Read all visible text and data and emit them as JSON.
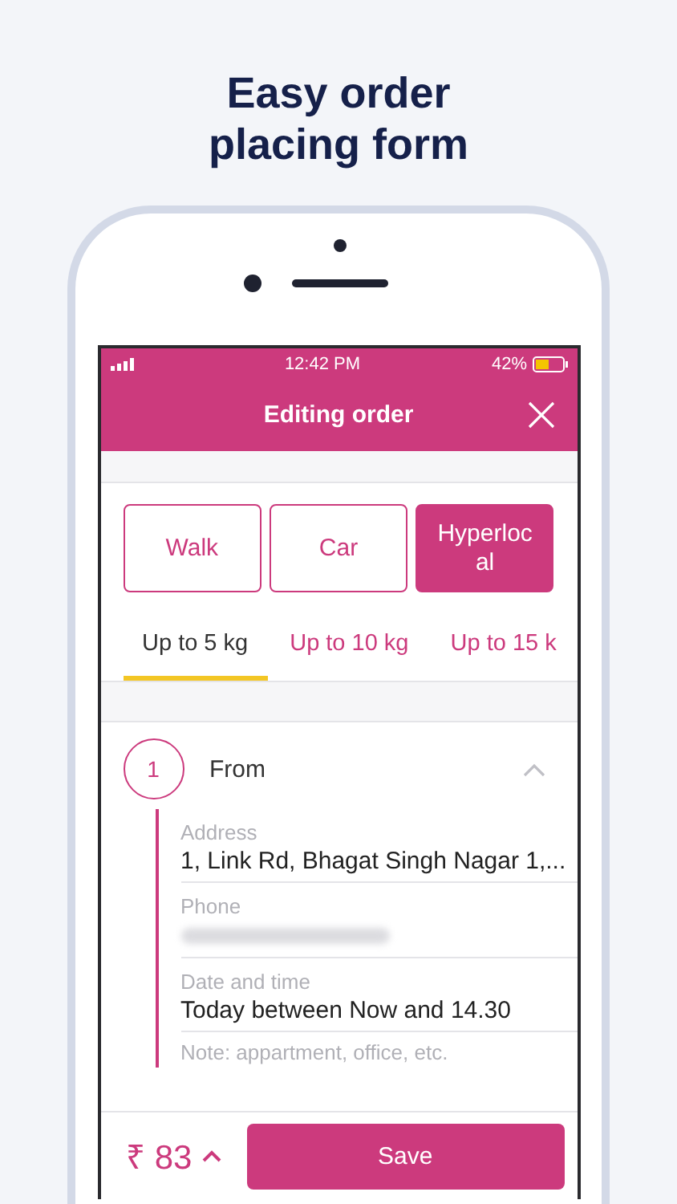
{
  "headline": "Easy order placing form",
  "status_bar": {
    "time": "12:42 PM",
    "battery": "42%"
  },
  "header": {
    "title": "Editing order"
  },
  "transport_options": [
    {
      "label": "Walk",
      "selected": false
    },
    {
      "label": "Car",
      "selected": false
    },
    {
      "label": "Hyperlocal",
      "selected": true
    }
  ],
  "weight_tabs": [
    {
      "label": "Up to 5 kg",
      "selected": true
    },
    {
      "label": "Up to 10 kg",
      "selected": false
    },
    {
      "label": "Up to 15 k",
      "selected": false
    }
  ],
  "step": {
    "number": "1",
    "title": "From",
    "expanded": true,
    "fields": [
      {
        "kind": "text",
        "label": "Address",
        "value": "1, Link Rd, Bhagat Singh Nagar 1,..."
      },
      {
        "kind": "blurred",
        "label": "Phone"
      },
      {
        "kind": "text",
        "label": "Date and time",
        "value": "Today between Now and 14.30"
      },
      {
        "kind": "note",
        "placeholder": "Note: appartment, office, etc."
      }
    ]
  },
  "footer": {
    "price": "₹ 83",
    "save_button": "Save"
  }
}
